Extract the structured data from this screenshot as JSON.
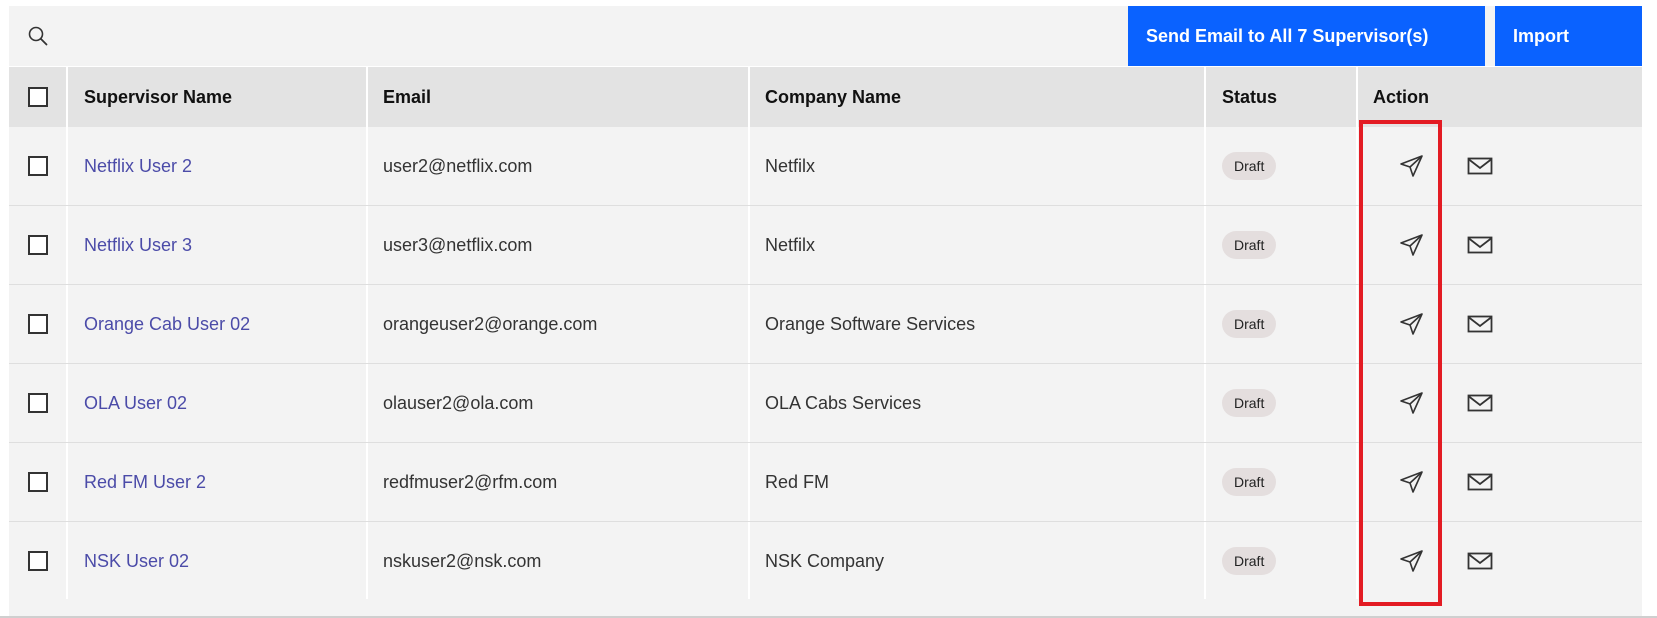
{
  "toolbar": {
    "search_icon": "search-icon",
    "send_all_label": "Send Email to All 7 Supervisor(s)",
    "import_label": "Import"
  },
  "table": {
    "headers": {
      "name": "Supervisor Name",
      "email": "Email",
      "company": "Company Name",
      "status": "Status",
      "action": "Action"
    },
    "rows": [
      {
        "name": "Netflix User 2",
        "email": "user2@netflix.com",
        "company": "Netfilx",
        "status": "Draft"
      },
      {
        "name": "Netflix User 3",
        "email": "user3@netflix.com",
        "company": "Netfilx",
        "status": "Draft"
      },
      {
        "name": "Orange Cab User 02",
        "email": "orangeuser2@orange.com",
        "company": "Orange Software Services",
        "status": "Draft"
      },
      {
        "name": "OLA User 02",
        "email": "olauser2@ola.com",
        "company": "OLA Cabs Services",
        "status": "Draft"
      },
      {
        "name": "Red FM User 2",
        "email": "redfmuser2@rfm.com",
        "company": "Red FM",
        "status": "Draft"
      },
      {
        "name": "NSK User 02",
        "email": "nskuser2@nsk.com",
        "company": "NSK Company",
        "status": "Draft"
      }
    ]
  },
  "colors": {
    "primary": "#0a62ff",
    "link": "#4b4ba8",
    "highlight": "#e31b23",
    "badge_bg": "#e4dede"
  },
  "icons": {
    "row_send": "send-paper-plane-icon",
    "row_mail": "envelope-icon"
  }
}
